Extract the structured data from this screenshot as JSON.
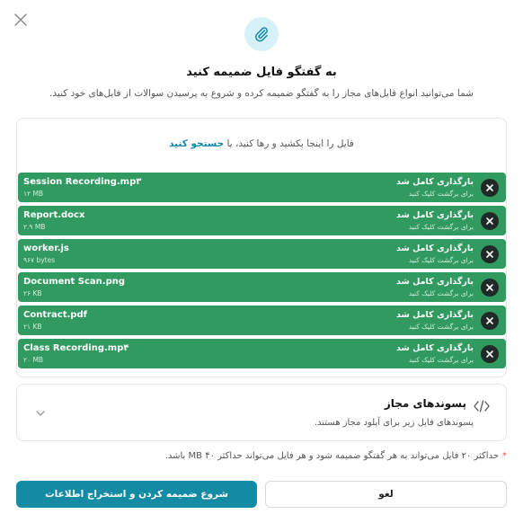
{
  "dialog": {
    "title": "به گفتگو فایل ضمیمه کنید",
    "subtitle": "شما می‌توانید انواع فایل‌های مجاز را به گفتگو ضمیمه کرده و شروع به پرسیدن سوالات از فایل‌های خود کنید.",
    "close_icon": "close-icon",
    "header_icon": "paperclip-icon",
    "accent_color": "#138ba5"
  },
  "upload": {
    "drop_text": "فایل را اینجا بکشید و رها کنید، یا",
    "browse_link": "جستجو کنید",
    "files": [
      {
        "name": "Session Recording.mp۳",
        "size": "۱۲ MB",
        "status": "بارگذاری کامل شد",
        "hint": "برای برگشت کلیک کنید"
      },
      {
        "name": "Report.docx",
        "size": "۲.۹ MB",
        "status": "بارگذاری کامل شد",
        "hint": "برای برگشت کلیک کنید"
      },
      {
        "name": "worker.js",
        "size": "۹۶۷ bytes",
        "status": "بارگذاری کامل شد",
        "hint": "برای برگشت کلیک کنید"
      },
      {
        "name": "Document Scan.png",
        "size": "۲۶ KB",
        "status": "بارگذاری کامل شد",
        "hint": "برای برگشت کلیک کنید"
      },
      {
        "name": "Contract.pdf",
        "size": "۲۱ KB",
        "status": "بارگذاری کامل شد",
        "hint": "برای برگشت کلیک کنید"
      },
      {
        "name": "Class Recording.mp۴",
        "size": "۲۰ MB",
        "status": "بارگذاری کامل شد",
        "hint": "برای برگشت کلیک کنید"
      }
    ],
    "file_row_color": "#319a60"
  },
  "extensions": {
    "title": "پسوندهای مجاز",
    "subtitle": "پسوندهای فایل زیر برای آپلود مجاز هستند.",
    "icon": "code-icon",
    "chevron": "chevron-down-icon"
  },
  "note": {
    "star": "*",
    "text": "حداکثر ۲۰ فایل می‌تواند به هر گفتگو ضمیمه شود و هر فایل می‌تواند حداکثر ۴۰ MB باشد."
  },
  "actions": {
    "primary_label": "شروع ضمیمه کردن و استخراج اطلاعات",
    "cancel_label": "لغو"
  }
}
